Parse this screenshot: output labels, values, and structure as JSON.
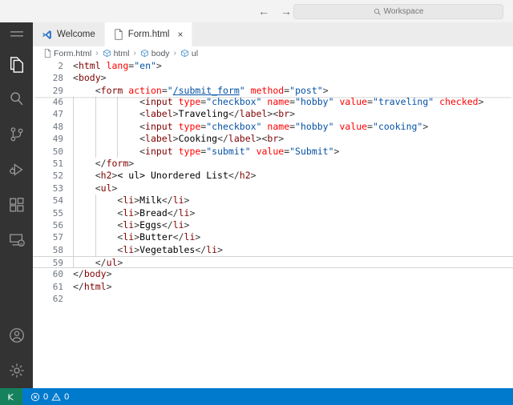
{
  "titlebar": {
    "back_icon": "arrow-left-icon",
    "forward_icon": "arrow-right-icon",
    "back_glyph": "←",
    "forward_glyph": "→",
    "search_placeholder": "Workspace",
    "search_icon": "search-icon"
  },
  "activitybar": {
    "items": [
      {
        "name": "menu-icon",
        "label": "Menu"
      },
      {
        "name": "explorer-icon",
        "label": "Explorer"
      },
      {
        "name": "search-icon",
        "label": "Search"
      },
      {
        "name": "source-control-icon",
        "label": "Source Control"
      },
      {
        "name": "run-debug-icon",
        "label": "Run and Debug"
      },
      {
        "name": "extensions-icon",
        "label": "Extensions"
      },
      {
        "name": "remote-explorer-icon",
        "label": "Remote Explorer"
      },
      {
        "name": "account-icon",
        "label": "Accounts"
      },
      {
        "name": "gear-icon",
        "label": "Manage"
      }
    ]
  },
  "tabs": [
    {
      "label": "Welcome",
      "icon": "vscode-logo-icon",
      "active": false,
      "closable": false
    },
    {
      "label": "Form.html",
      "icon": "html-file-icon",
      "active": true,
      "closable": true,
      "close_glyph": "×"
    }
  ],
  "breadcrumb": {
    "items": [
      {
        "label": "Form.html",
        "icon": "file-icon"
      },
      {
        "label": "html",
        "icon": "symbol-field-icon"
      },
      {
        "label": "body",
        "icon": "symbol-field-icon"
      },
      {
        "label": "ul",
        "icon": "symbol-field-icon"
      }
    ],
    "separator": "›"
  },
  "editor": {
    "sticky_lines": [
      {
        "number": "2",
        "indent": 0,
        "tokens": [
          {
            "t": "pun",
            "v": "<"
          },
          {
            "t": "tag",
            "v": "html"
          },
          {
            "t": "txt",
            "v": " "
          },
          {
            "t": "attr",
            "v": "lang"
          },
          {
            "t": "pun",
            "v": "="
          },
          {
            "t": "str",
            "v": "\"en\""
          },
          {
            "t": "pun",
            "v": ">"
          }
        ]
      },
      {
        "number": "28",
        "indent": 0,
        "tokens": [
          {
            "t": "pun",
            "v": "<"
          },
          {
            "t": "tag",
            "v": "body"
          },
          {
            "t": "pun",
            "v": ">"
          }
        ]
      },
      {
        "number": "29",
        "indent": 1,
        "tokens": [
          {
            "t": "pun",
            "v": "<"
          },
          {
            "t": "tag",
            "v": "form"
          },
          {
            "t": "txt",
            "v": " "
          },
          {
            "t": "attr",
            "v": "action"
          },
          {
            "t": "pun",
            "v": "="
          },
          {
            "t": "str",
            "v": "\""
          },
          {
            "t": "link",
            "v": "/submit_form"
          },
          {
            "t": "str",
            "v": "\""
          },
          {
            "t": "txt",
            "v": " "
          },
          {
            "t": "attr",
            "v": "method"
          },
          {
            "t": "pun",
            "v": "="
          },
          {
            "t": "str",
            "v": "\"post\""
          },
          {
            "t": "pun",
            "v": ">"
          }
        ]
      }
    ],
    "lines": [
      {
        "number": "46",
        "indent": 3,
        "current": false,
        "tokens": [
          {
            "t": "pun",
            "v": "<"
          },
          {
            "t": "tag",
            "v": "input"
          },
          {
            "t": "txt",
            "v": " "
          },
          {
            "t": "attr",
            "v": "type"
          },
          {
            "t": "pun",
            "v": "="
          },
          {
            "t": "str",
            "v": "\"checkbox\""
          },
          {
            "t": "txt",
            "v": " "
          },
          {
            "t": "attr",
            "v": "name"
          },
          {
            "t": "pun",
            "v": "="
          },
          {
            "t": "str",
            "v": "\"hobby\""
          },
          {
            "t": "txt",
            "v": " "
          },
          {
            "t": "attr",
            "v": "value"
          },
          {
            "t": "pun",
            "v": "="
          },
          {
            "t": "str",
            "v": "\"traveling\""
          },
          {
            "t": "txt",
            "v": " "
          },
          {
            "t": "attr",
            "v": "checked"
          },
          {
            "t": "pun",
            "v": ">"
          }
        ]
      },
      {
        "number": "47",
        "indent": 3,
        "current": false,
        "tokens": [
          {
            "t": "pun",
            "v": "<"
          },
          {
            "t": "tag",
            "v": "label"
          },
          {
            "t": "pun",
            "v": ">"
          },
          {
            "t": "txt",
            "v": "Traveling"
          },
          {
            "t": "pun",
            "v": "</"
          },
          {
            "t": "tag",
            "v": "label"
          },
          {
            "t": "pun",
            "v": ">"
          },
          {
            "t": "pun",
            "v": "<"
          },
          {
            "t": "tag",
            "v": "br"
          },
          {
            "t": "pun",
            "v": ">"
          }
        ]
      },
      {
        "number": "48",
        "indent": 3,
        "current": false,
        "tokens": [
          {
            "t": "pun",
            "v": "<"
          },
          {
            "t": "tag",
            "v": "input"
          },
          {
            "t": "txt",
            "v": " "
          },
          {
            "t": "attr",
            "v": "type"
          },
          {
            "t": "pun",
            "v": "="
          },
          {
            "t": "str",
            "v": "\"checkbox\""
          },
          {
            "t": "txt",
            "v": " "
          },
          {
            "t": "attr",
            "v": "name"
          },
          {
            "t": "pun",
            "v": "="
          },
          {
            "t": "str",
            "v": "\"hobby\""
          },
          {
            "t": "txt",
            "v": " "
          },
          {
            "t": "attr",
            "v": "value"
          },
          {
            "t": "pun",
            "v": "="
          },
          {
            "t": "str",
            "v": "\"cooking\""
          },
          {
            "t": "pun",
            "v": ">"
          }
        ]
      },
      {
        "number": "49",
        "indent": 3,
        "current": false,
        "tokens": [
          {
            "t": "pun",
            "v": "<"
          },
          {
            "t": "tag",
            "v": "label"
          },
          {
            "t": "pun",
            "v": ">"
          },
          {
            "t": "txt",
            "v": "Cooking"
          },
          {
            "t": "pun",
            "v": "</"
          },
          {
            "t": "tag",
            "v": "label"
          },
          {
            "t": "pun",
            "v": ">"
          },
          {
            "t": "pun",
            "v": "<"
          },
          {
            "t": "tag",
            "v": "br"
          },
          {
            "t": "pun",
            "v": ">"
          }
        ]
      },
      {
        "number": "50",
        "indent": 3,
        "current": false,
        "tokens": [
          {
            "t": "pun",
            "v": "<"
          },
          {
            "t": "tag",
            "v": "input"
          },
          {
            "t": "txt",
            "v": " "
          },
          {
            "t": "attr",
            "v": "type"
          },
          {
            "t": "pun",
            "v": "="
          },
          {
            "t": "str",
            "v": "\"submit\""
          },
          {
            "t": "txt",
            "v": " "
          },
          {
            "t": "attr",
            "v": "value"
          },
          {
            "t": "pun",
            "v": "="
          },
          {
            "t": "str",
            "v": "\"Submit\""
          },
          {
            "t": "pun",
            "v": ">"
          }
        ]
      },
      {
        "number": "51",
        "indent": 1,
        "current": false,
        "tokens": [
          {
            "t": "pun",
            "v": "</"
          },
          {
            "t": "tag",
            "v": "form"
          },
          {
            "t": "pun",
            "v": ">"
          }
        ]
      },
      {
        "number": "52",
        "indent": 1,
        "current": false,
        "tokens": [
          {
            "t": "pun",
            "v": "<"
          },
          {
            "t": "tag",
            "v": "h2"
          },
          {
            "t": "pun",
            "v": ">"
          },
          {
            "t": "txt",
            "v": "< ul> Unordered List"
          },
          {
            "t": "pun",
            "v": "</"
          },
          {
            "t": "tag",
            "v": "h2"
          },
          {
            "t": "pun",
            "v": ">"
          }
        ]
      },
      {
        "number": "53",
        "indent": 1,
        "current": false,
        "tokens": [
          {
            "t": "pun",
            "v": "<"
          },
          {
            "t": "tag",
            "v": "ul"
          },
          {
            "t": "pun",
            "v": ">"
          }
        ]
      },
      {
        "number": "54",
        "indent": 2,
        "current": false,
        "tokens": [
          {
            "t": "pun",
            "v": "<"
          },
          {
            "t": "tag",
            "v": "li"
          },
          {
            "t": "pun",
            "v": ">"
          },
          {
            "t": "txt",
            "v": "Milk"
          },
          {
            "t": "pun",
            "v": "</"
          },
          {
            "t": "tag",
            "v": "li"
          },
          {
            "t": "pun",
            "v": ">"
          }
        ]
      },
      {
        "number": "55",
        "indent": 2,
        "current": false,
        "tokens": [
          {
            "t": "pun",
            "v": "<"
          },
          {
            "t": "tag",
            "v": "li"
          },
          {
            "t": "pun",
            "v": ">"
          },
          {
            "t": "txt",
            "v": "Bread"
          },
          {
            "t": "pun",
            "v": "</"
          },
          {
            "t": "tag",
            "v": "li"
          },
          {
            "t": "pun",
            "v": ">"
          }
        ]
      },
      {
        "number": "56",
        "indent": 2,
        "current": false,
        "tokens": [
          {
            "t": "pun",
            "v": "<"
          },
          {
            "t": "tag",
            "v": "li"
          },
          {
            "t": "pun",
            "v": ">"
          },
          {
            "t": "txt",
            "v": "Eggs"
          },
          {
            "t": "pun",
            "v": "</"
          },
          {
            "t": "tag",
            "v": "li"
          },
          {
            "t": "pun",
            "v": ">"
          }
        ]
      },
      {
        "number": "57",
        "indent": 2,
        "current": false,
        "tokens": [
          {
            "t": "pun",
            "v": "<"
          },
          {
            "t": "tag",
            "v": "li"
          },
          {
            "t": "pun",
            "v": ">"
          },
          {
            "t": "txt",
            "v": "Butter"
          },
          {
            "t": "pun",
            "v": "</"
          },
          {
            "t": "tag",
            "v": "li"
          },
          {
            "t": "pun",
            "v": ">"
          }
        ]
      },
      {
        "number": "58",
        "indent": 2,
        "current": false,
        "tokens": [
          {
            "t": "pun",
            "v": "<"
          },
          {
            "t": "tag",
            "v": "li"
          },
          {
            "t": "pun",
            "v": ">"
          },
          {
            "t": "txt",
            "v": "Vegetables"
          },
          {
            "t": "pun",
            "v": "</"
          },
          {
            "t": "tag",
            "v": "li"
          },
          {
            "t": "pun",
            "v": ">"
          }
        ]
      },
      {
        "number": "59",
        "indent": 1,
        "current": true,
        "tokens": [
          {
            "t": "pun",
            "v": "</"
          },
          {
            "t": "tag",
            "v": "ul"
          },
          {
            "t": "pun",
            "v": ">"
          }
        ]
      },
      {
        "number": "60",
        "indent": 0,
        "current": false,
        "tokens": [
          {
            "t": "pun",
            "v": "</"
          },
          {
            "t": "tag",
            "v": "body"
          },
          {
            "t": "pun",
            "v": ">"
          }
        ]
      },
      {
        "number": "61",
        "indent": 0,
        "current": false,
        "tokens": [
          {
            "t": "pun",
            "v": "</"
          },
          {
            "t": "tag",
            "v": "html"
          },
          {
            "t": "pun",
            "v": ">"
          }
        ]
      },
      {
        "number": "62",
        "indent": 0,
        "current": false,
        "tokens": []
      }
    ]
  },
  "statusbar": {
    "remote_icon": "remote-window-icon",
    "error_icon": "error-circle-icon",
    "error_count": "0",
    "warning_icon": "warning-triangle-icon",
    "warning_count": "0"
  },
  "colors": {
    "accent": "#007acc",
    "remote_green": "#16825d",
    "activity_bar": "#333333",
    "tag": "#800000",
    "attribute": "#ff0000",
    "string": "#0451a5",
    "text": "#000000"
  }
}
